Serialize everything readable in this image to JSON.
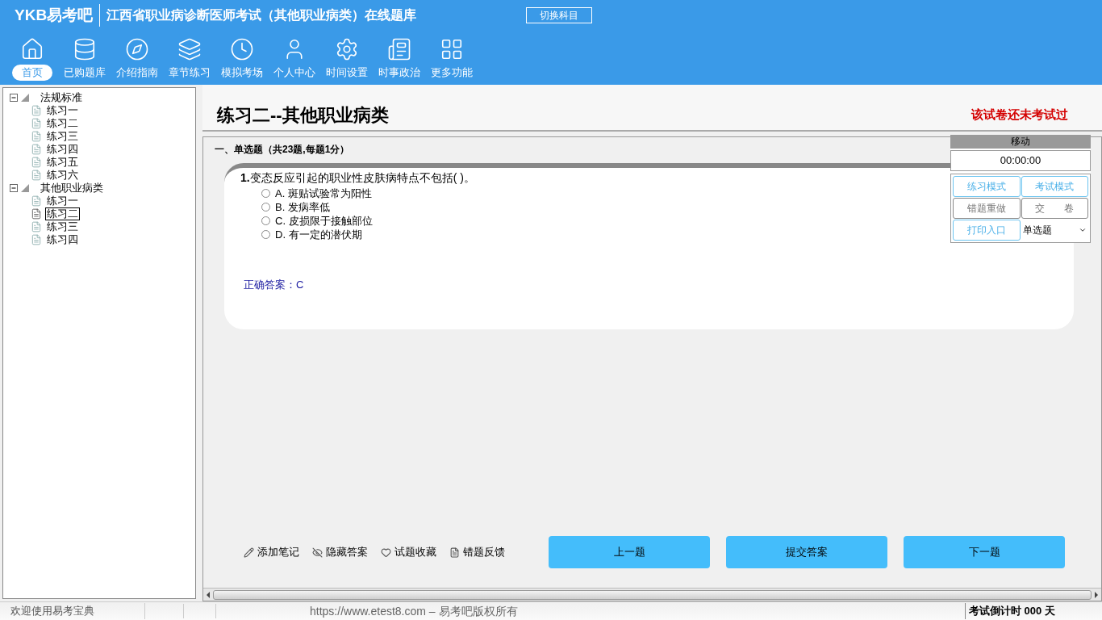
{
  "header": {
    "logo": "YKB易考吧",
    "title": "江西省职业病诊断医师考试（其他职业病类）在线题库",
    "switch_button": "切换科目"
  },
  "toolbar": [
    {
      "label": "首页",
      "selected": true
    },
    {
      "label": "已购题库",
      "selected": false
    },
    {
      "label": "介绍指南",
      "selected": false
    },
    {
      "label": "章节练习",
      "selected": false
    },
    {
      "label": "模拟考场",
      "selected": false
    },
    {
      "label": "个人中心",
      "selected": false
    },
    {
      "label": "时间设置",
      "selected": false
    },
    {
      "label": "时事政治",
      "selected": false
    },
    {
      "label": "更多功能",
      "selected": false
    }
  ],
  "tree": [
    {
      "label": "法规标准",
      "expanded": true,
      "children": [
        {
          "label": "练习一",
          "selected": false
        },
        {
          "label": "练习二",
          "selected": false
        },
        {
          "label": "练习三",
          "selected": false
        },
        {
          "label": "练习四",
          "selected": false
        },
        {
          "label": "练习五",
          "selected": false
        },
        {
          "label": "练习六",
          "selected": false
        }
      ]
    },
    {
      "label": "其他职业病类",
      "expanded": true,
      "children": [
        {
          "label": "练习一",
          "selected": false
        },
        {
          "label": "练习二",
          "selected": true
        },
        {
          "label": "练习三",
          "selected": false
        },
        {
          "label": "练习四",
          "selected": false
        }
      ]
    }
  ],
  "paper": {
    "title": "练习二--其他职业病类",
    "status": "该试卷还未考试过"
  },
  "section": "一、单选题（共23题,每题1分）",
  "question": {
    "number": "1.",
    "text": "变态反应引起的职业性皮肤病特点不包括( )。",
    "options": [
      {
        "label": "A. 斑贴试验常为阳性",
        "selected": false
      },
      {
        "label": "B. 发病率低",
        "selected": false
      },
      {
        "label": "C. 皮损限于接触部位",
        "selected": false
      },
      {
        "label": "D. 有一定的潜伏期",
        "selected": false
      }
    ],
    "answer": "正确答案：C"
  },
  "panel": {
    "title": "移动",
    "timer": "00:00:00",
    "buttons": [
      {
        "label": "练习模式",
        "kind": "accent"
      },
      {
        "label": "考试模式",
        "kind": "accent"
      },
      {
        "label": "错题重做",
        "kind": "plain"
      },
      {
        "label": "交　　卷",
        "kind": "plain"
      },
      {
        "label": "打印入口",
        "kind": "accent"
      }
    ],
    "type_select": "单选题"
  },
  "actions": [
    "添加笔记",
    "隐藏答案",
    "试题收藏",
    "错题反馈"
  ],
  "nav_buttons": [
    "上一题",
    "提交答案",
    "下一题"
  ],
  "status_bar": {
    "welcome": "欢迎使用易考宝典",
    "copyright": "https://www.etest8.com – 易考吧版权所有",
    "countdown": "考试倒计时 000 天"
  }
}
